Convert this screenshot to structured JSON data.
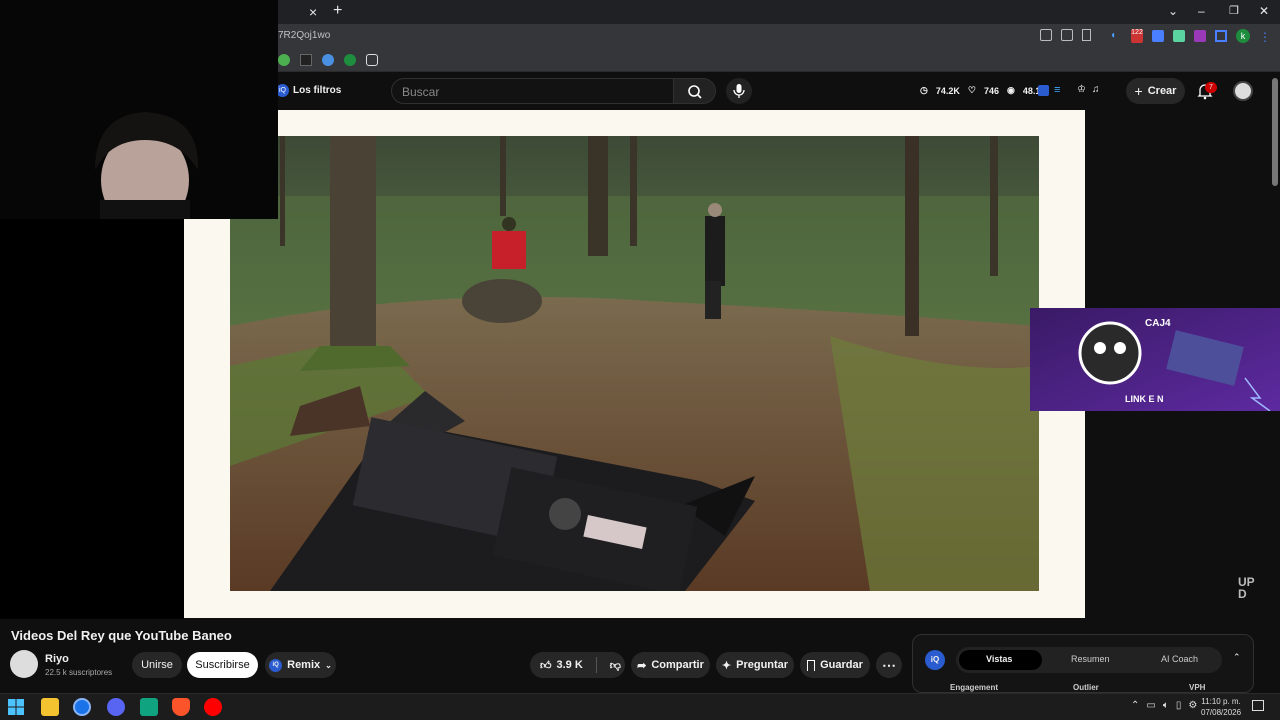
{
  "browser": {
    "url_fragment": "7R2Qoj1wo",
    "tab_close": "×",
    "new_tab": "+",
    "win_controls": [
      "⌄",
      "–",
      "❐",
      "✕"
    ],
    "ext_badge": "122"
  },
  "header": {
    "filters_label": "Los filtros",
    "search_placeholder": "Buscar",
    "stats": {
      "views": "74.2K",
      "likes": "746",
      "watch": "48.1K"
    },
    "create_label": "Crear",
    "notif_count": "7"
  },
  "video": {
    "title": "Videos Del Rey que YouTube Baneo",
    "channel": "Riyo",
    "subs": "22.5 k suscriptores",
    "join_label": "Unirse",
    "subscribe_label": "Suscribirse",
    "remix_label": "Remix",
    "likes": "3.9 K",
    "share_label": "Compartir",
    "ask_label": "Preguntar",
    "save_label": "Guardar",
    "promo_text": "CAJ4",
    "promo_sub": "LINK E N",
    "watermark": "UP D"
  },
  "panel": {
    "tabs": [
      "Vistas",
      "Resumen",
      "AI Coach"
    ],
    "cols": [
      "Engagement",
      "Outlier",
      "VPH"
    ]
  },
  "taskbar": {
    "time": "11:10 p. m.",
    "date": "07/08/2026"
  },
  "colors": {
    "subscribe_bg": "#ffffff",
    "accent": "#3ea6ff",
    "notif": "#cc0000"
  }
}
